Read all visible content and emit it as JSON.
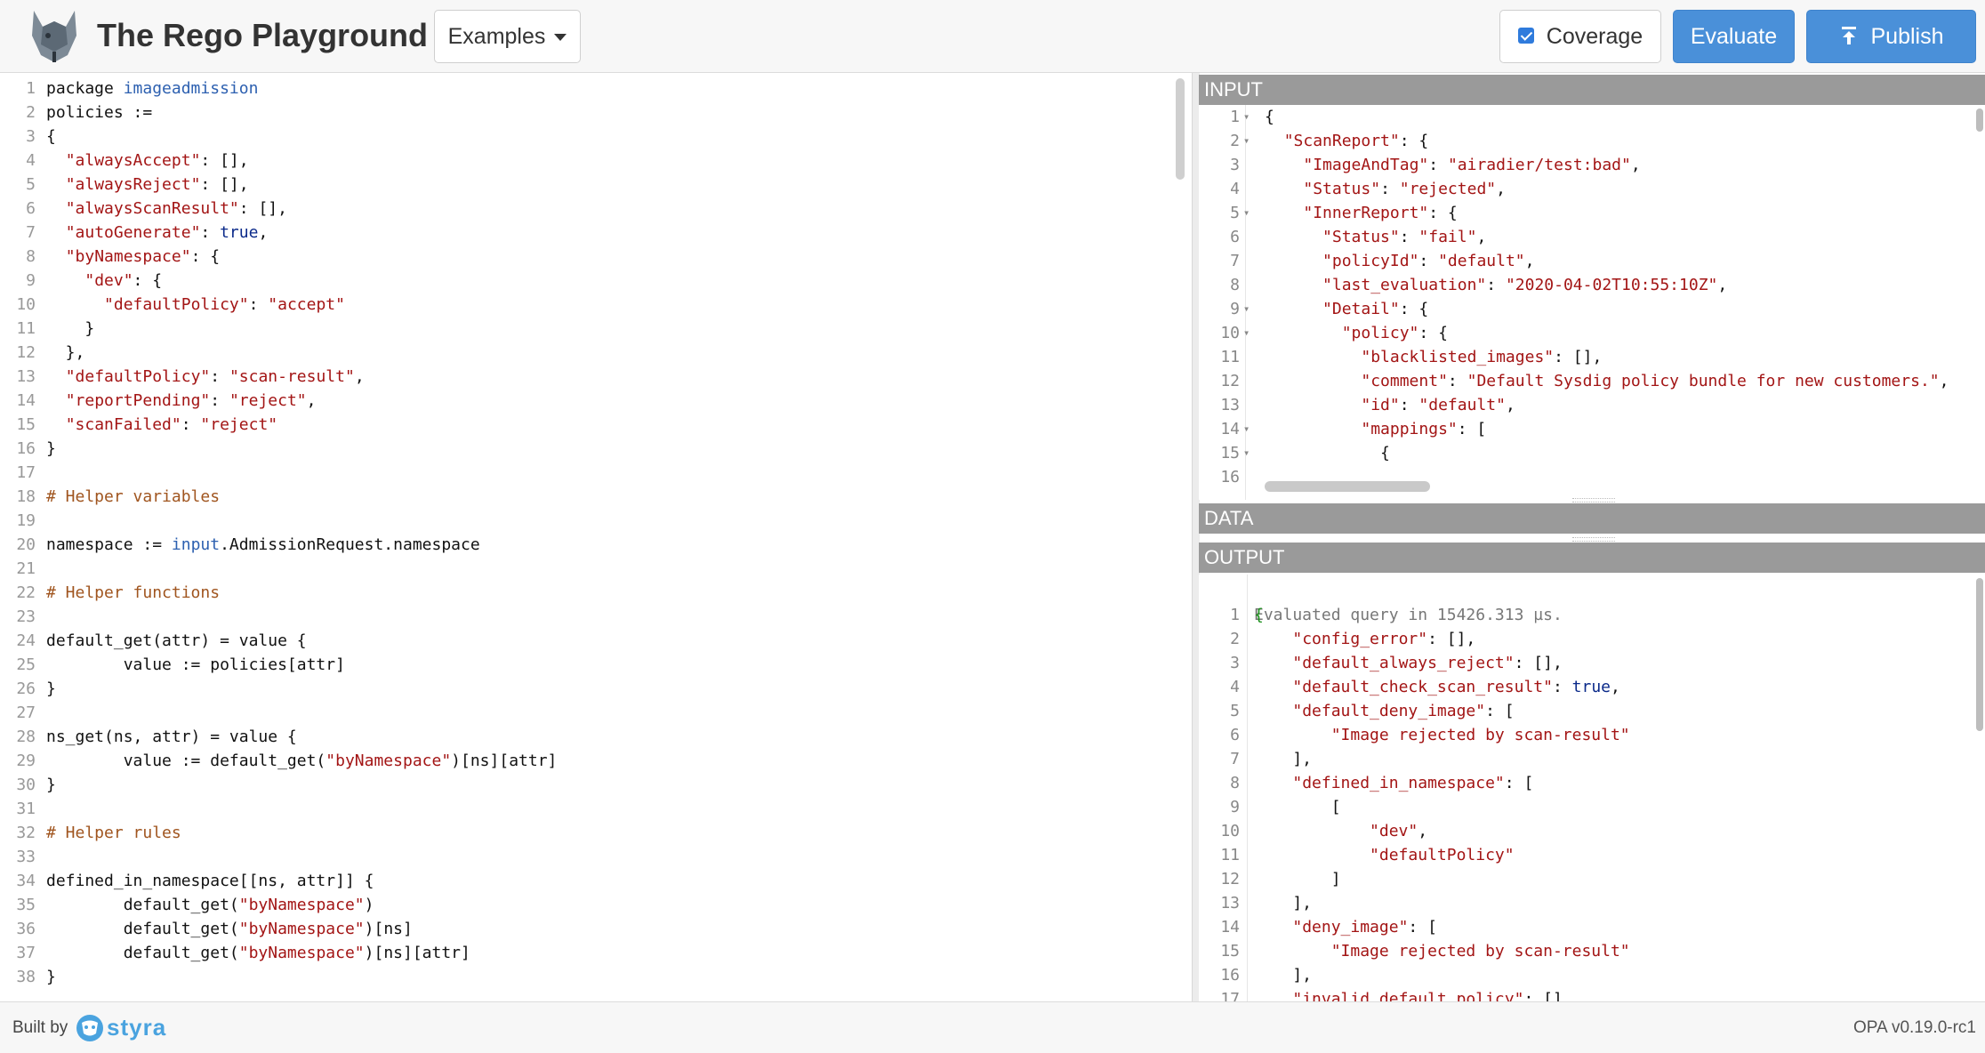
{
  "header": {
    "title": "The Rego Playground",
    "examples_label": "Examples",
    "coverage_label": "Coverage",
    "evaluate_label": "Evaluate",
    "publish_label": "Publish"
  },
  "policy_editor": {
    "lines": [
      "package imageadmission",
      "policies :=",
      "{",
      "  \"alwaysAccept\": [],",
      "  \"alwaysReject\": [],",
      "  \"alwaysScanResult\": [],",
      "  \"autoGenerate\": true,",
      "  \"byNamespace\": {",
      "    \"dev\": {",
      "      \"defaultPolicy\": \"accept\"",
      "    }",
      "  },",
      "  \"defaultPolicy\": \"scan-result\",",
      "  \"reportPending\": \"reject\",",
      "  \"scanFailed\": \"reject\"",
      "}",
      "",
      "# Helper variables",
      "",
      "namespace := input.AdmissionRequest.namespace",
      "",
      "# Helper functions",
      "",
      "default_get(attr) = value {",
      "        value := policies[attr]",
      "}",
      "",
      "ns_get(ns, attr) = value {",
      "        value := default_get(\"byNamespace\")[ns][attr]",
      "}",
      "",
      "# Helper rules",
      "",
      "defined_in_namespace[[ns, attr]] {",
      "        default_get(\"byNamespace\")",
      "        default_get(\"byNamespace\")[ns]",
      "        default_get(\"byNamespace\")[ns][attr]",
      "}"
    ]
  },
  "input_panel": {
    "label": "INPUT",
    "lines": [
      "{",
      "  \"ScanReport\": {",
      "    \"ImageAndTag\": \"airadier/test:bad\",",
      "    \"Status\": \"rejected\",",
      "    \"InnerReport\": {",
      "      \"Status\": \"fail\",",
      "      \"policyId\": \"default\",",
      "      \"last_evaluation\": \"2020-04-02T10:55:10Z\",",
      "      \"Detail\": {",
      "        \"policy\": {",
      "          \"blacklisted_images\": [],",
      "          \"comment\": \"Default Sysdig policy bundle for new customers.\",",
      "          \"id\": \"default\",",
      "          \"mappings\": [",
      "            {",
      ""
    ]
  },
  "data_panel": {
    "label": "DATA"
  },
  "output_panel": {
    "label": "OUTPUT",
    "eval_message": "Evaluated query in 15426.313 µs.",
    "lines": [
      "{",
      "    \"config_error\": [],",
      "    \"default_always_reject\": [],",
      "    \"default_check_scan_result\": true,",
      "    \"default_deny_image\": [",
      "        \"Image rejected by scan-result\"",
      "    ],",
      "    \"defined_in_namespace\": [",
      "        [",
      "            \"dev\",",
      "            \"defaultPolicy\"",
      "        ]",
      "    ],",
      "    \"deny_image\": [",
      "        \"Image rejected by scan-result\"",
      "    ],",
      "    \"invalid_default_policy\": []"
    ]
  },
  "footer": {
    "built_by": "Built by",
    "brand": "styra",
    "version": "OPA v0.19.0-rc1"
  },
  "colors": {
    "primary_button": "#4a90d9",
    "panel_header": "#9a9a9a",
    "string": "#a31515",
    "comment": "#a0551f",
    "builtin": "#2d60b0"
  }
}
